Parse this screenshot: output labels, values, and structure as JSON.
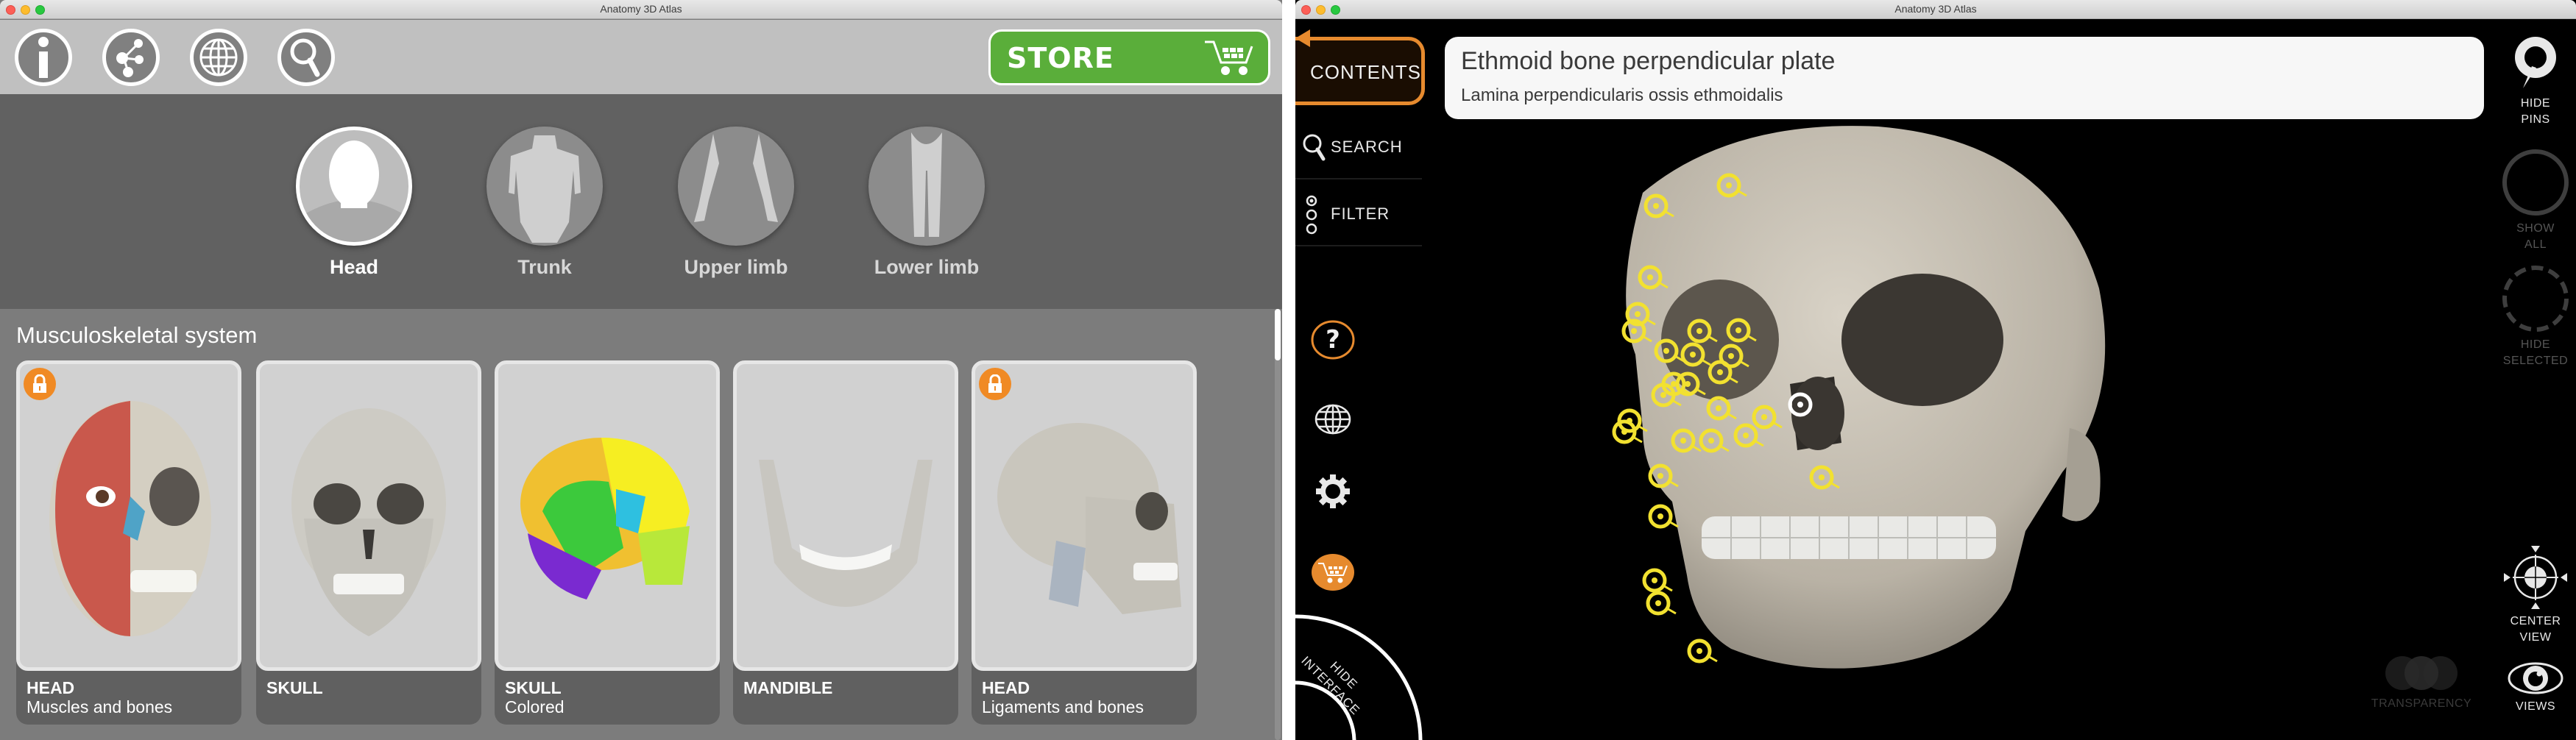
{
  "left_window": {
    "title": "Anatomy 3D Atlas",
    "toolbar": {
      "buttons": [
        {
          "name": "info",
          "icon": "info-icon"
        },
        {
          "name": "share",
          "icon": "share-icon"
        },
        {
          "name": "language",
          "icon": "globe-icon"
        },
        {
          "name": "search",
          "icon": "search-icon"
        }
      ],
      "store_label": "STORE",
      "store_color": "#5aae3a"
    },
    "regions": [
      {
        "label": "Head",
        "active": true
      },
      {
        "label": "Trunk",
        "active": false
      },
      {
        "label": "Upper limb",
        "active": false
      },
      {
        "label": "Lower limb",
        "active": false
      }
    ],
    "section_title": "Musculoskeletal system",
    "cards": [
      {
        "title": "HEAD",
        "subtitle": "Muscles and bones",
        "locked": true
      },
      {
        "title": "SKULL",
        "subtitle": "",
        "locked": false
      },
      {
        "title": "SKULL",
        "subtitle": "Colored",
        "locked": false
      },
      {
        "title": "MANDIBLE",
        "subtitle": "",
        "locked": false
      },
      {
        "title": "HEAD",
        "subtitle": "Ligaments and bones",
        "locked": true
      }
    ],
    "lock_color": "#f08a24"
  },
  "right_window": {
    "title": "Anatomy 3D Atlas",
    "contents_label": "CONTENTS",
    "accent_color": "#e68a2e",
    "search_label": "SEARCH",
    "filter_label": "FILTER",
    "selected_structure": {
      "name": "Ethmoid bone perpendicular plate",
      "latin": "Lamina perpendicularis ossis ethmoidalis"
    },
    "side_icons": [
      "help-icon",
      "globe-icon",
      "gear-icon",
      "cart-icon"
    ],
    "hide_interface_label_1": "HIDE",
    "hide_interface_label_2": "INTERFACE",
    "right_controls": {
      "hide_pins": [
        "HIDE",
        "PINS"
      ],
      "show_all": [
        "SHOW",
        "ALL"
      ],
      "hide_selected": [
        "HIDE",
        "SELECTED"
      ],
      "center_view": [
        "CENTER",
        "VIEW"
      ],
      "views": "VIEWS"
    },
    "transparency_label": "TRANSPARENCY",
    "pin_color": "#f2e130"
  }
}
